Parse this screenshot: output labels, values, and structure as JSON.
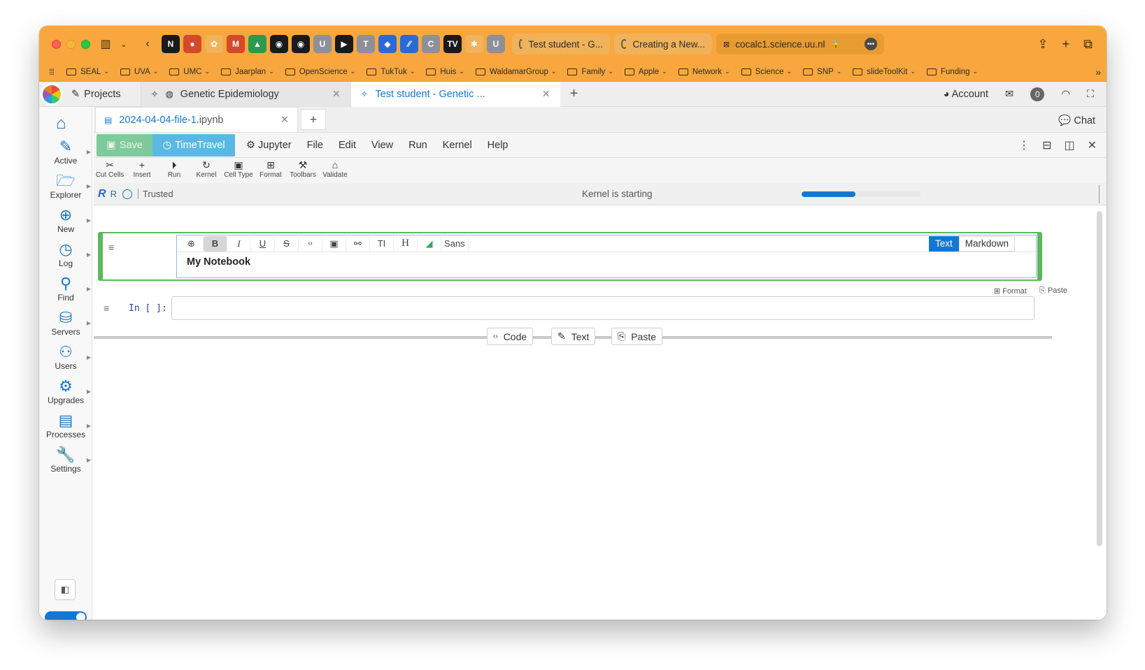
{
  "browser": {
    "tabs": [
      {
        "label": "Test student - G..."
      },
      {
        "label": "Creating a New..."
      },
      {
        "label": "cocalc1.science.uu.nl"
      }
    ],
    "pinned": [
      "N",
      "G",
      "M",
      "",
      "",
      "",
      "U",
      "",
      "T",
      "",
      "",
      "C",
      "TV",
      "",
      "U"
    ]
  },
  "bookmarks": [
    "SEAL",
    "UVA",
    "UMC",
    "Jaarplan",
    "OpenScience",
    "TukTuk",
    "Huis",
    "WaldamarGroup",
    "Family",
    "Apple",
    "Network",
    "Science",
    "SNP",
    "slideToolKit",
    "Funding"
  ],
  "appbar": {
    "projects_label": "Projects",
    "tabs": [
      {
        "label": "Genetic Epidemiology"
      },
      {
        "label": "Test student - Genetic ..."
      }
    ],
    "account_label": "Account",
    "notifications_count": "0"
  },
  "sidebar": {
    "items": [
      {
        "label": "Active",
        "icon": "✎"
      },
      {
        "label": "Explorer",
        "icon": "🗁"
      },
      {
        "label": "New",
        "icon": "⊕"
      },
      {
        "label": "Log",
        "icon": "◷"
      },
      {
        "label": "Find",
        "icon": "⚲"
      },
      {
        "label": "Servers",
        "icon": "⛁"
      },
      {
        "label": "Users",
        "icon": "⚇"
      },
      {
        "label": "Upgrades",
        "icon": "⚙"
      },
      {
        "label": "Processes",
        "icon": "▤"
      },
      {
        "label": "Settings",
        "icon": "🔧"
      }
    ]
  },
  "file": {
    "name": "2024-04-04-file-1",
    "ext": ".ipynb",
    "chat_label": "Chat"
  },
  "menubar": {
    "save_label": "Save",
    "timetravel_label": "TimeTravel",
    "items": [
      "Jupyter",
      "File",
      "Edit",
      "View",
      "Run",
      "Kernel",
      "Help"
    ]
  },
  "toolbar": {
    "tools": [
      {
        "label": "Cut Cells",
        "icon": "✂"
      },
      {
        "label": "Insert",
        "icon": "+"
      },
      {
        "label": "Run",
        "icon": "⏵"
      },
      {
        "label": "Kernel",
        "icon": "↻"
      },
      {
        "label": "Cell Type",
        "icon": "▣"
      },
      {
        "label": "Format",
        "icon": "⊞"
      },
      {
        "label": "Toolbars",
        "icon": "⚒"
      },
      {
        "label": "Validate",
        "icon": "⌂"
      }
    ]
  },
  "kernel": {
    "name": "R",
    "trusted_label": "Trusted",
    "status": "Kernel is starting",
    "progress": 0.45
  },
  "markdown_cell": {
    "font_label": "Sans",
    "mode_text": "Text",
    "mode_markdown": "Markdown",
    "content": "My Notebook"
  },
  "cell_actions": {
    "format": "Format",
    "paste": "Paste"
  },
  "code_cell": {
    "prompt": "In [ ]:"
  },
  "insert_buttons": {
    "code": "Code",
    "text": "Text",
    "paste": "Paste"
  }
}
